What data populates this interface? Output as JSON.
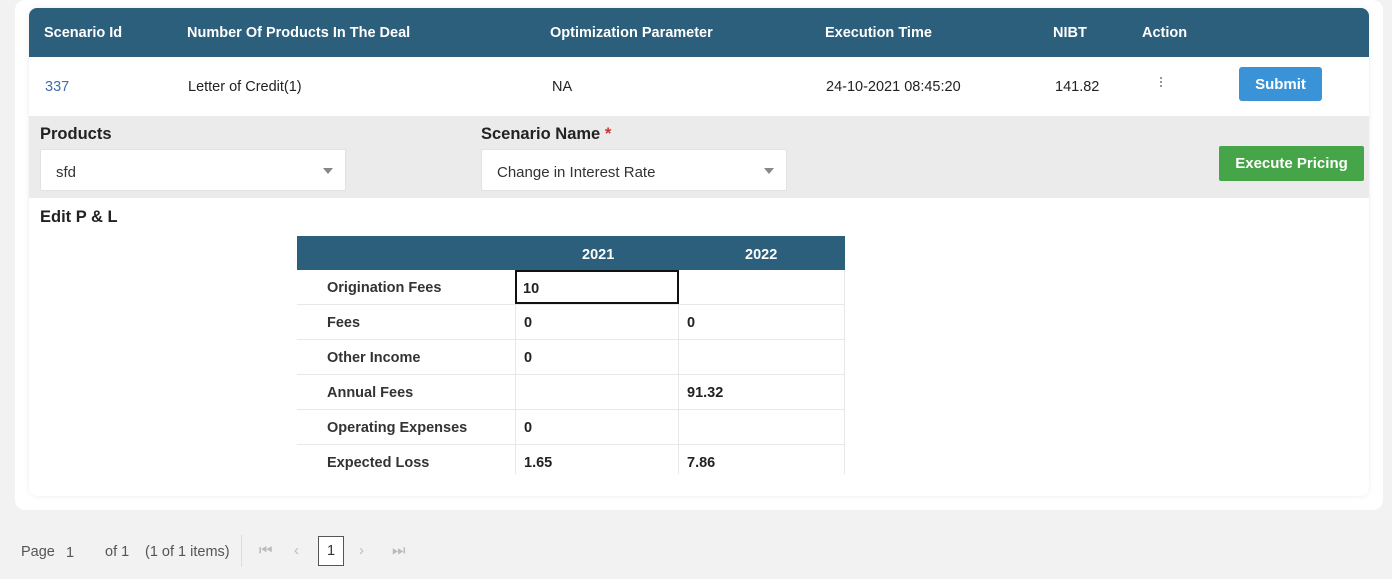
{
  "scenario_table": {
    "headers": [
      "Scenario Id",
      "Number Of Products In The Deal",
      "Optimization Parameter",
      "Execution Time",
      "NIBT",
      "Action"
    ],
    "row": {
      "scenario_id": "337",
      "products": "Letter of Credit(1)",
      "optimization": "NA",
      "execution_time": "24-10-2021 08:45:20",
      "nibt": "141.82",
      "submit_label": "Submit"
    }
  },
  "filters": {
    "products_label": "Products",
    "products_value": "sfd",
    "scenario_label": "Scenario Name",
    "scenario_required": "*",
    "scenario_value": "Change in Interest Rate",
    "execute_label": "Execute Pricing"
  },
  "pl": {
    "title": "Edit P & L",
    "years": [
      "2021",
      "2022"
    ],
    "rows": [
      {
        "label": "Origination Fees",
        "y2021": "10",
        "y2022": ""
      },
      {
        "label": "Fees",
        "y2021": "0",
        "y2022": "0"
      },
      {
        "label": "Other Income",
        "y2021": "0",
        "y2022": ""
      },
      {
        "label": "Annual Fees",
        "y2021": "",
        "y2022": "91.32"
      },
      {
        "label": "Operating Expenses",
        "y2021": "0",
        "y2022": ""
      },
      {
        "label": "Expected Loss",
        "y2021": "1.65",
        "y2022": "7.86"
      }
    ]
  },
  "pager": {
    "page_label": "Page",
    "page_value": "1",
    "of_label": "of 1",
    "items_label": "(1 of 1 items)",
    "current": "1"
  },
  "colors": {
    "header_bg": "#2c5f7c",
    "submit_bg": "#3a93d6",
    "execute_bg": "#46a548",
    "required": "#d32f2f"
  },
  "icons": {
    "action_menu": "more-vertical-icon",
    "dropdown": "chevron-down-icon",
    "first": "first-page-icon",
    "prev": "prev-page-icon",
    "next": "next-page-icon",
    "last": "last-page-icon"
  }
}
